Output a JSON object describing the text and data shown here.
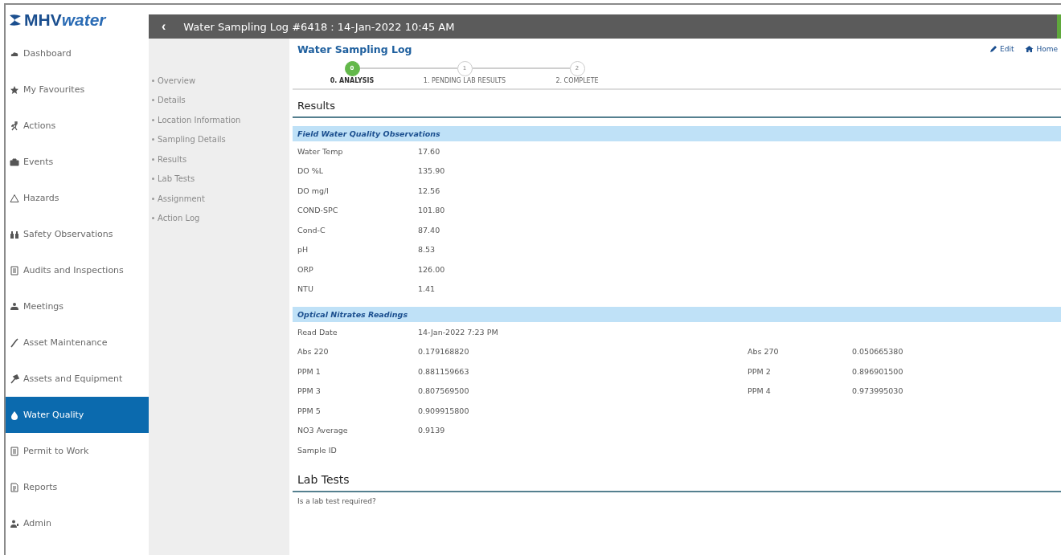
{
  "logo": {
    "strong": "MHV",
    "light": "water"
  },
  "sidebar": {
    "items": [
      {
        "label": "Dashboard",
        "selected": false
      },
      {
        "label": "My Favourites",
        "selected": false
      },
      {
        "label": "Actions",
        "selected": false
      },
      {
        "label": "Events",
        "selected": false
      },
      {
        "label": "Hazards",
        "selected": false
      },
      {
        "label": "Safety Observations",
        "selected": false
      },
      {
        "label": "Audits and Inspections",
        "selected": false
      },
      {
        "label": "Meetings",
        "selected": false
      },
      {
        "label": "Asset Maintenance",
        "selected": false
      },
      {
        "label": "Assets and Equipment",
        "selected": false
      },
      {
        "label": "Water Quality",
        "selected": true
      },
      {
        "label": "Permit to Work",
        "selected": false
      },
      {
        "label": "Reports",
        "selected": false
      },
      {
        "label": "Admin",
        "selected": false
      }
    ]
  },
  "title_bar": {
    "back": "‹",
    "title": "Water Sampling Log #6418 : 14-Jan-2022 10:45 AM"
  },
  "section_nav": [
    "Overview",
    "Details",
    "Location Information",
    "Sampling Details",
    "Results",
    "Lab Tests",
    "Assignment",
    "Action Log"
  ],
  "page_title": "Water Sampling Log",
  "actions": [
    "Edit",
    "Home"
  ],
  "stepper": [
    {
      "number": "0",
      "label": "0. ANALYSIS",
      "selected": true
    },
    {
      "number": "1",
      "label": "1. PENDING LAB RESULTS",
      "selected": false
    },
    {
      "number": "2",
      "label": "2. COMPLETE",
      "selected": false
    }
  ],
  "results": {
    "heading": "Results",
    "groups": [
      {
        "title": "Field Water Quality Observations",
        "rows": [
          {
            "cells": [
              "Water Temp",
              "17.60"
            ]
          },
          {
            "cells": [
              "DO %L",
              "135.90"
            ]
          },
          {
            "cells": [
              "DO mg/l",
              "12.56"
            ]
          },
          {
            "cells": [
              "COND-SPC",
              "101.80"
            ]
          },
          {
            "cells": [
              "Cond-C",
              "87.40"
            ]
          },
          {
            "cells": [
              "pH",
              "8.53"
            ]
          },
          {
            "cells": [
              "ORP",
              "126.00"
            ]
          },
          {
            "cells": [
              "NTU",
              "1.41"
            ]
          }
        ]
      },
      {
        "title": "Optical Nitrates Readings",
        "rows": [
          {
            "cells": [
              "Read Date",
              "14-Jan-2022 7:23 PM"
            ]
          },
          {
            "cells": [
              "Abs 220",
              "0.179168820",
              "Abs 270",
              "0.050665380"
            ]
          },
          {
            "cells": [
              "PPM 1",
              "0.881159663",
              "PPM 2",
              "0.896901500"
            ]
          },
          {
            "cells": [
              "PPM 3",
              "0.807569500",
              "PPM 4",
              "0.973995030"
            ]
          },
          {
            "cells": [
              "PPM 5",
              "0.909915800"
            ]
          },
          {
            "cells": [
              "NO3 Average",
              "0.9139"
            ]
          },
          {
            "cells": [
              "Sample ID"
            ]
          }
        ]
      }
    ]
  },
  "lab_tests": {
    "heading": "Lab Tests",
    "question": "Is a lab test required?"
  }
}
